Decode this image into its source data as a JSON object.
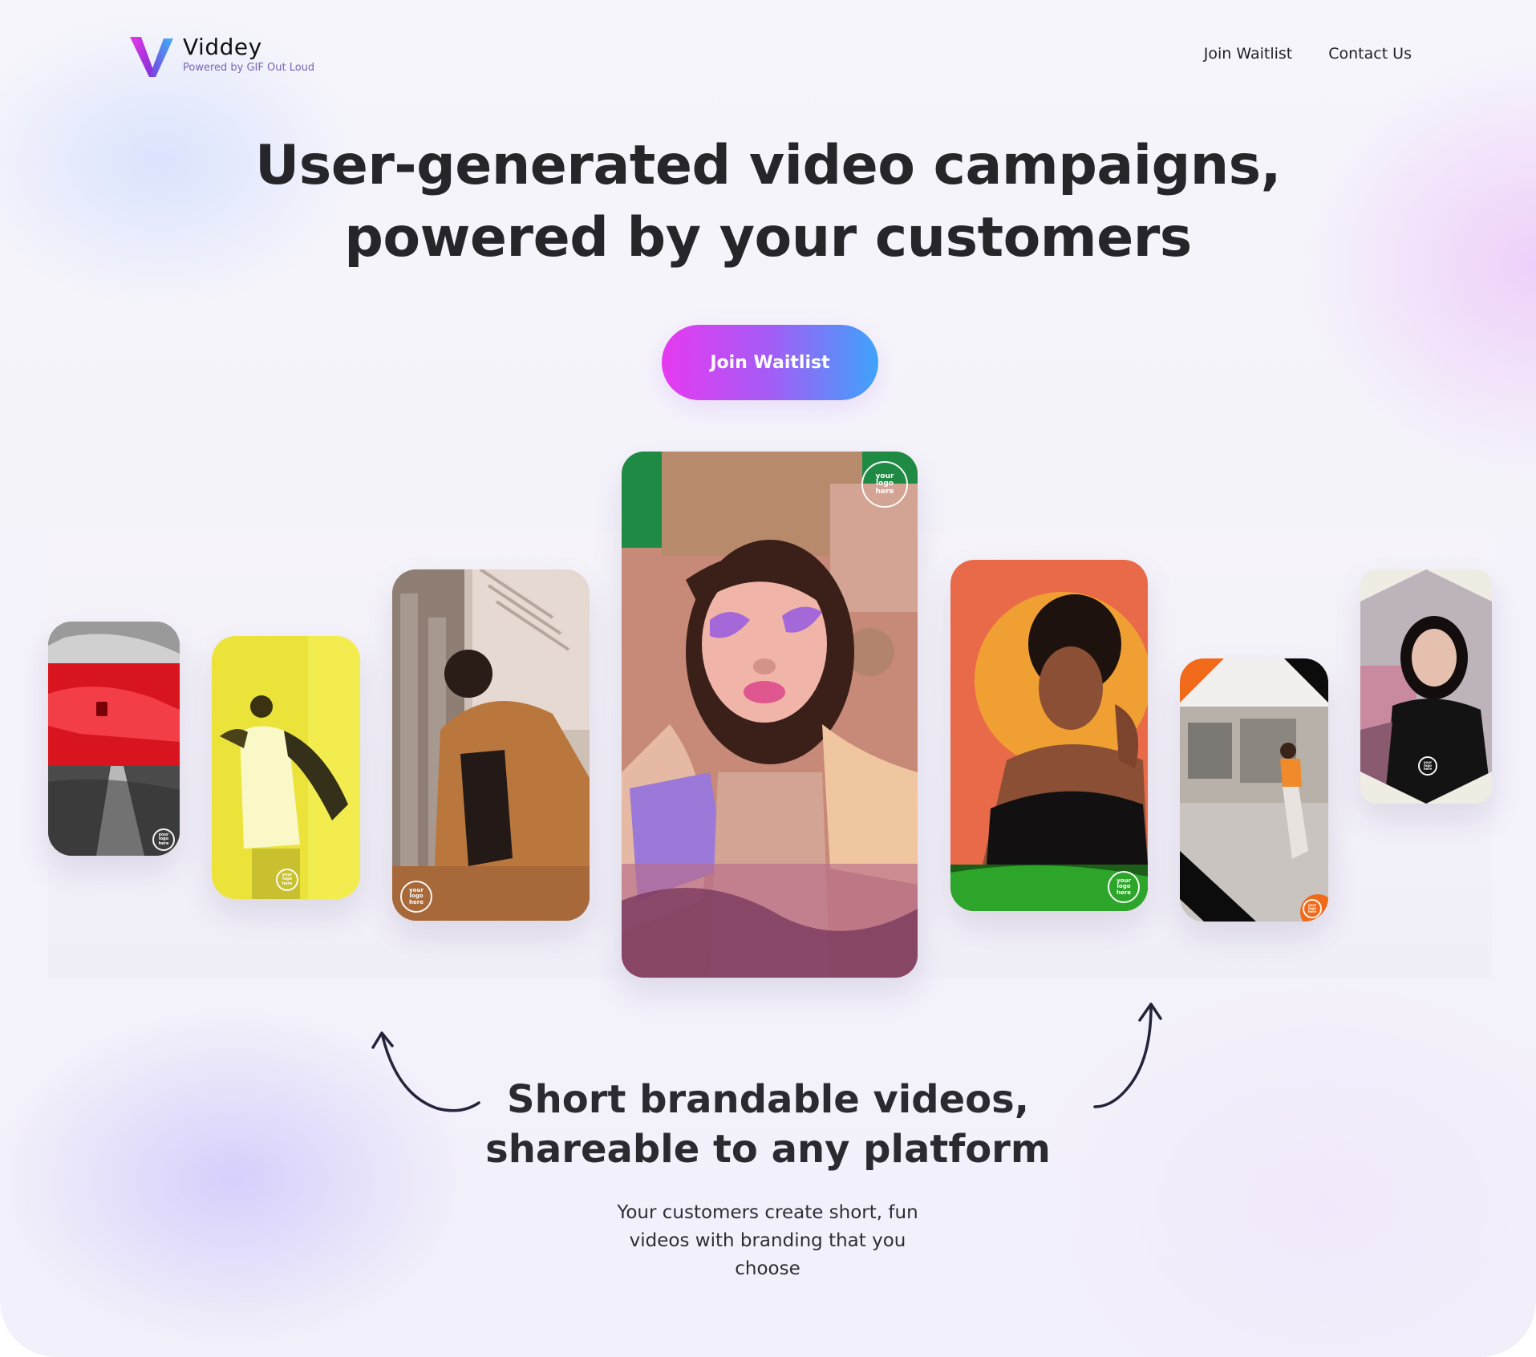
{
  "header": {
    "brand_name": "Viddey",
    "brand_tagline": "Powered by GIF Out Loud",
    "nav": [
      {
        "label": "Join Waitlist"
      },
      {
        "label": "Contact Us"
      }
    ]
  },
  "hero": {
    "title_line1": "User-generated video campaigns,",
    "title_line2": "powered by your customers",
    "cta_label": "Join Waitlist"
  },
  "gallery": {
    "logo_badge_lines": [
      "your",
      "logo",
      "here"
    ]
  },
  "feature": {
    "title_line1": "Short brandable videos,",
    "title_line2": "shareable to any platform",
    "description": "Your customers create short, fun videos with branding that you choose"
  },
  "colors": {
    "cta_gradient_start": "#e63af0",
    "cta_gradient_end": "#3ea3fb",
    "text": "#25252a"
  }
}
